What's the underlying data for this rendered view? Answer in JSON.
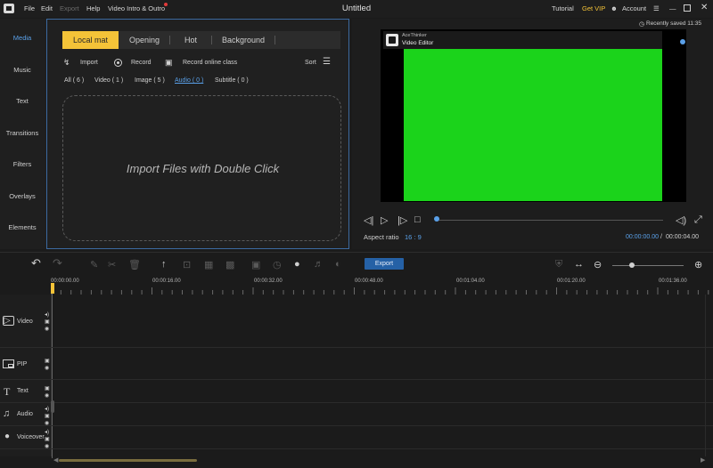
{
  "menu": {
    "items": [
      "File",
      "Edit",
      "Export",
      "Help",
      "Video Intro & Outro"
    ],
    "disabled": [
      "Export"
    ],
    "title": "Untitled",
    "tutorial": "Tutorial",
    "get_vip": "Get VIP",
    "account": "Account"
  },
  "sidebar": {
    "items": [
      {
        "label": "Media"
      },
      {
        "label": "Music"
      },
      {
        "label": "Text"
      },
      {
        "label": "Transitions"
      },
      {
        "label": "Filters"
      },
      {
        "label": "Overlays"
      },
      {
        "label": "Elements"
      }
    ]
  },
  "media": {
    "tabs": [
      {
        "label": "Local mat"
      },
      {
        "label": "Opening"
      },
      {
        "label": "Hot"
      },
      {
        "label": "Background"
      }
    ],
    "tools": {
      "import": "Import",
      "record": "Record",
      "record_online": "Record online class",
      "sort": "Sort"
    },
    "filters": [
      {
        "label": "All ( 6 )"
      },
      {
        "label": "Video ( 1 )"
      },
      {
        "label": "Image ( 5 )"
      },
      {
        "label": "Audio ( 0 )"
      },
      {
        "label": "Subtitle ( 0 )"
      }
    ],
    "dropzone_text": "Import Files with Double Click"
  },
  "preview": {
    "recently_saved": "Recently saved 11:35",
    "watermark_brand": "AceThinker",
    "watermark_product": "Video Editor",
    "aspect_label": "Aspect ratio",
    "aspect_value": "16 : 9",
    "time_current": "00:00:00.00",
    "time_separator": "/",
    "time_total": "00:00:04.00",
    "green_color": "#1bd31b"
  },
  "toolbar": {
    "export_label": "Export"
  },
  "ruler": {
    "labels": [
      "00:00:00.00",
      "00:00:16.00",
      "00:00:32.00",
      "00:00:48.00",
      "00:01:04.00",
      "00:01:20.00",
      "00:01:36.00"
    ]
  },
  "tracks": [
    {
      "label": "Video"
    },
    {
      "label": "PIP"
    },
    {
      "label": "Text"
    },
    {
      "label": "Audio"
    },
    {
      "label": "Voiceover"
    }
  ],
  "colors": {
    "accent_yellow": "#f4c338",
    "accent_blue": "#5aa0e8",
    "export_blue": "#2561a6"
  }
}
